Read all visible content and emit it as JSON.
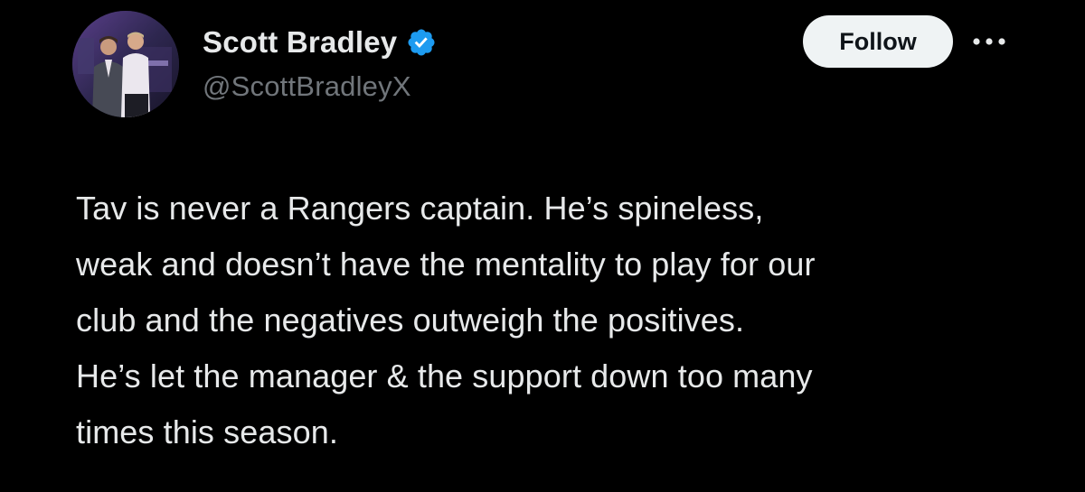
{
  "author": {
    "display_name": "Scott Bradley",
    "handle": "@ScottBradleyX",
    "verified": true,
    "avatar_icon": "profile-photo"
  },
  "actions": {
    "follow_label": "Follow",
    "more_icon": "more-horizontal-icon"
  },
  "tweet": {
    "lines": [
      "Tav is never a Rangers captain. He’s spineless,",
      "weak and doesn’t have the mentality to play for our",
      "club and the negatives outweigh the positives.",
      "He’s let the manager & the support down too many",
      "times this season."
    ]
  },
  "colors": {
    "background": "#000000",
    "text_primary": "#e7e9ea",
    "text_secondary": "#71767b",
    "verified_badge": "#1d9bf0",
    "follow_button_bg": "#eff3f4",
    "follow_button_text": "#0f1419"
  }
}
